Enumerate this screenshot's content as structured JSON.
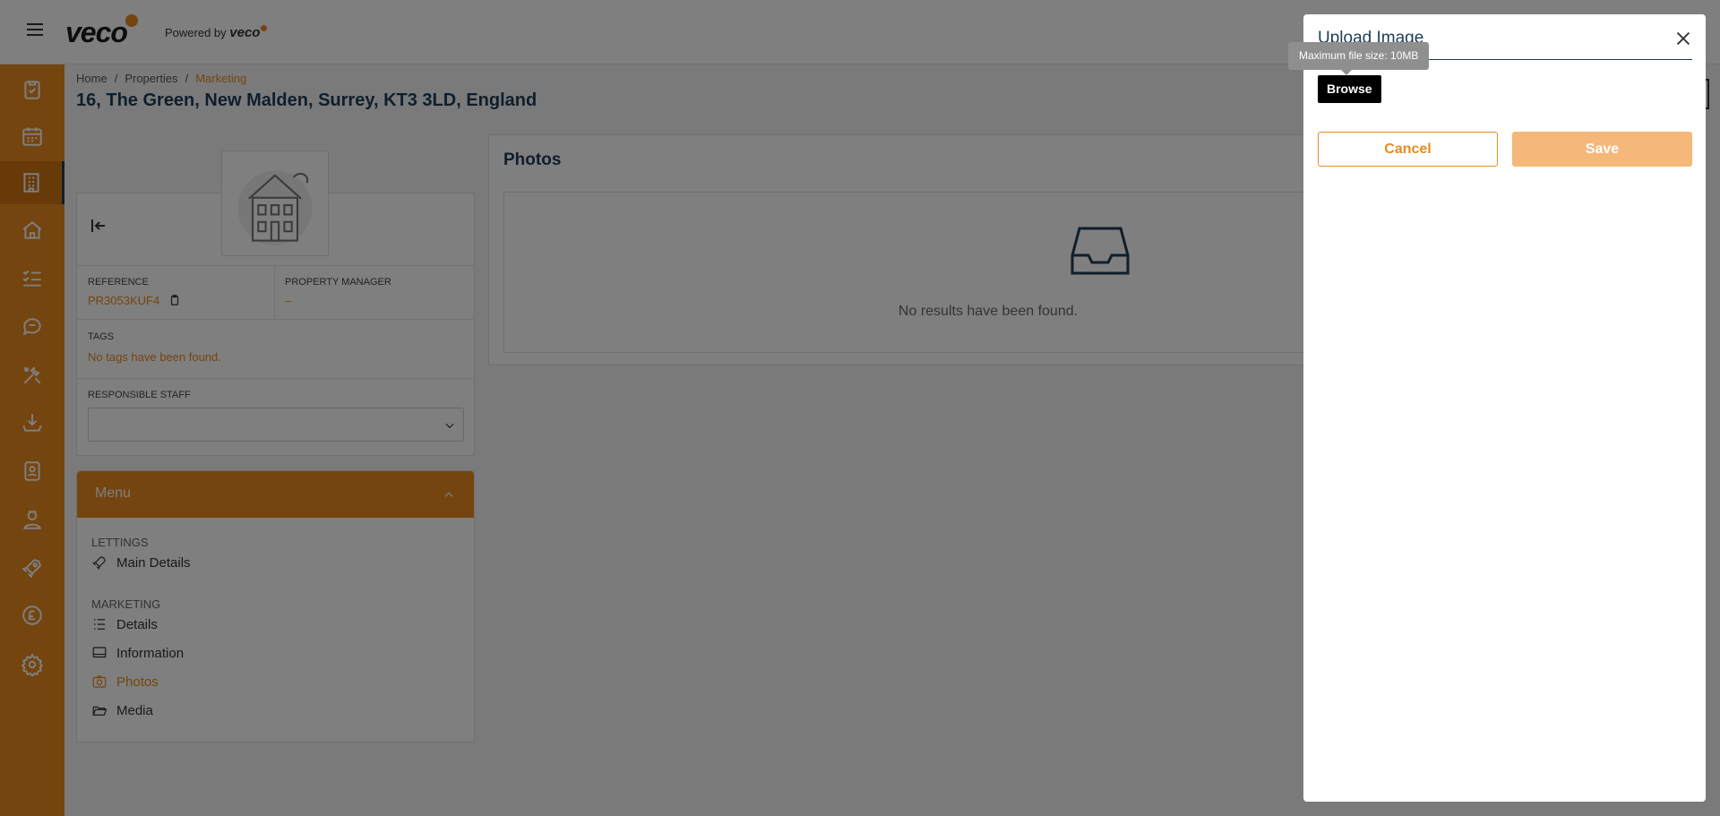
{
  "header": {
    "logo_text": "veco",
    "powered_by_label": "Powered by",
    "powered_by_brand": "veco"
  },
  "sidebar": {
    "items": [
      {
        "icon": "clipboard-check-icon"
      },
      {
        "icon": "calendar-icon"
      },
      {
        "icon": "building-icon",
        "active": true
      },
      {
        "icon": "house-icon"
      },
      {
        "icon": "checklist-icon"
      },
      {
        "icon": "chat-icon"
      },
      {
        "icon": "tools-icon"
      },
      {
        "icon": "download-tray-icon"
      },
      {
        "icon": "contact-book-icon"
      },
      {
        "icon": "user-badge-icon"
      },
      {
        "icon": "rocket-icon"
      },
      {
        "icon": "pound-icon"
      },
      {
        "icon": "gear-icon"
      }
    ]
  },
  "breadcrumb": {
    "home": "Home",
    "properties": "Properties",
    "current": "Marketing",
    "separator": "/"
  },
  "page_title": "16, The Green, New Malden, Surrey, KT3 3LD, England",
  "property_card": {
    "reference_label": "REFERENCE",
    "reference_value": "PR3053KUF4",
    "manager_label": "PROPERTY MANAGER",
    "manager_value": "–",
    "tags_label": "TAGS",
    "tags_value": "No tags have been found.",
    "staff_label": "RESPONSIBLE STAFF"
  },
  "menu": {
    "title": "Menu",
    "sections": [
      {
        "title": "LETTINGS",
        "items": [
          {
            "label": "Main Details",
            "icon": "rocket-icon"
          }
        ]
      },
      {
        "title": "MARKETING",
        "items": [
          {
            "label": "Details",
            "icon": "list-icon"
          },
          {
            "label": "Information",
            "icon": "monitor-icon"
          },
          {
            "label": "Photos",
            "icon": "camera-icon",
            "active": true
          },
          {
            "label": "Media",
            "icon": "folder-open-icon"
          }
        ]
      }
    ]
  },
  "photos": {
    "title": "Photos",
    "empty_message": "No results have been found."
  },
  "modal": {
    "title": "Upload Image",
    "tooltip": "Maximum file size: 10MB",
    "browse_label": "Browse",
    "cancel_label": "Cancel",
    "save_label": "Save"
  },
  "colors": {
    "accent": "#e88b1e",
    "navy": "#1f3c57",
    "overlay": "rgba(0,0,0,0.5)"
  }
}
